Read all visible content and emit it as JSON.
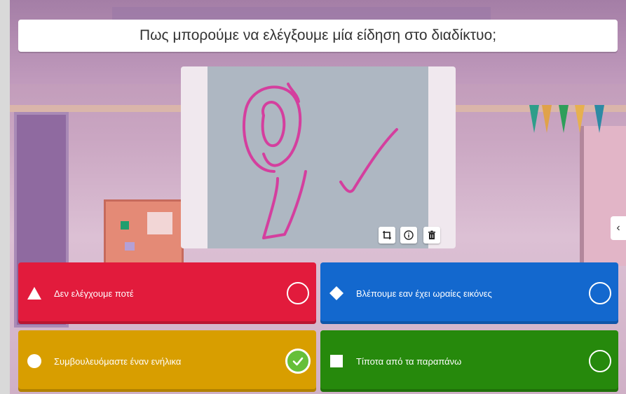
{
  "question": {
    "text": "Πως μπορούμε να ελέγξουμε μία είδηση στο διαδίκτυο;"
  },
  "image_tools": {
    "crop_icon": "crop-icon",
    "info_icon": "info-icon",
    "delete_icon": "trash-icon"
  },
  "side_toggle": {
    "glyph": "‹"
  },
  "answers": [
    {
      "label": "Δεν ελέγχουμε ποτέ",
      "shape": "triangle-icon",
      "color": "#e21b3c",
      "correct": false
    },
    {
      "label": "Βλέπουμε εαν έχει ωραίες εικόνες",
      "shape": "diamond-icon",
      "color": "#1368ce",
      "correct": false
    },
    {
      "label": "Συμβουλευόμαστε έναν ενήλικα",
      "shape": "circle-icon",
      "color": "#d89e00",
      "correct": true
    },
    {
      "label": "Τίποτα από τα παραπάνω",
      "shape": "square-icon",
      "color": "#26890c",
      "correct": false
    }
  ]
}
